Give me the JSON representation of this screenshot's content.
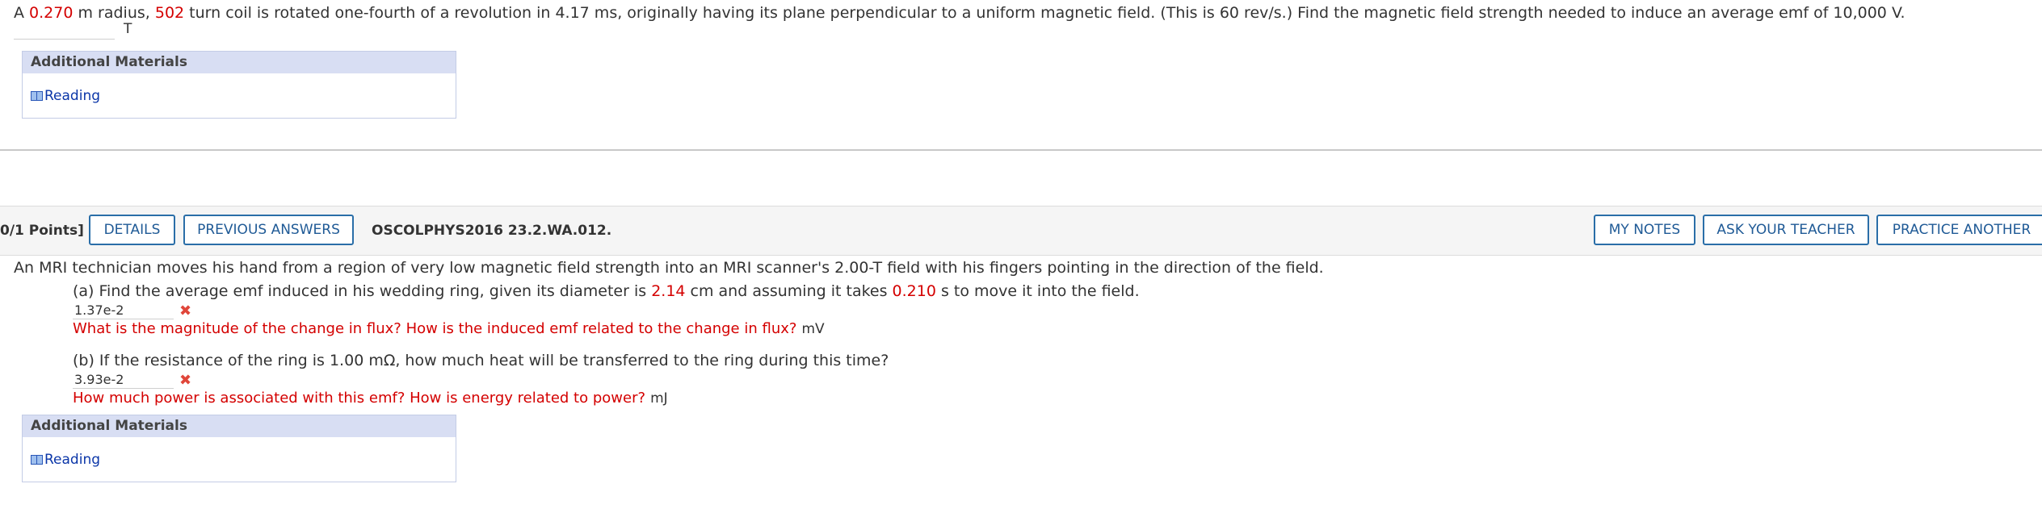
{
  "question1": {
    "text_a": "A ",
    "radius": "0.270",
    "text_b": " m radius, ",
    "turns": "502",
    "text_c": " turn coil is rotated one-fourth of a revolution in 4.17 ms, originally having its plane perpendicular to a uniform magnetic field. (This is 60 rev/s.) Find the magnetic field strength needed to induce an average emf of 10,000 V.",
    "answer_value": "",
    "unit": "T"
  },
  "additional_materials": {
    "heading": "Additional Materials",
    "link": "Reading"
  },
  "question2_bar": {
    "points": "0/1 Points]",
    "details": "DETAILS",
    "previous_answers": "PREVIOUS ANSWERS",
    "question_id": "OSCOLPHYS2016 23.2.WA.012.",
    "my_notes": "MY NOTES",
    "ask_teacher": "ASK YOUR TEACHER",
    "practice_another": "PRACTICE ANOTHER"
  },
  "question2": {
    "intro": "An MRI technician moves his hand from a region of very low magnetic field strength into an MRI scanner's 2.00-T field with his fingers pointing in the direction of the field.",
    "part_a": {
      "text_a": "(a) Find the average emf induced in his wedding ring, given its diameter is ",
      "diameter": "2.14",
      "text_b": " cm and assuming it takes ",
      "time": "0.210",
      "text_c": " s to move it into the field.",
      "answer": "1.37e-2",
      "status_icon": "incorrect-x-icon",
      "hint": "What is the magnitude of the change in flux? How is the induced emf related to the change in flux?",
      "unit": "mV"
    },
    "part_b": {
      "text": "(b) If the resistance of the ring is 1.00 mΩ, how much heat will be transferred to the ring during this time?",
      "answer": "3.93e-2",
      "status_icon": "incorrect-x-icon",
      "hint": "How much power is associated with this emf? How is energy related to power?",
      "unit": "mJ"
    }
  },
  "colors": {
    "accent_red": "#d40000",
    "link_blue": "#0b36a8",
    "button_border": "#2a6ea8",
    "materials_header": "#d8def3"
  }
}
